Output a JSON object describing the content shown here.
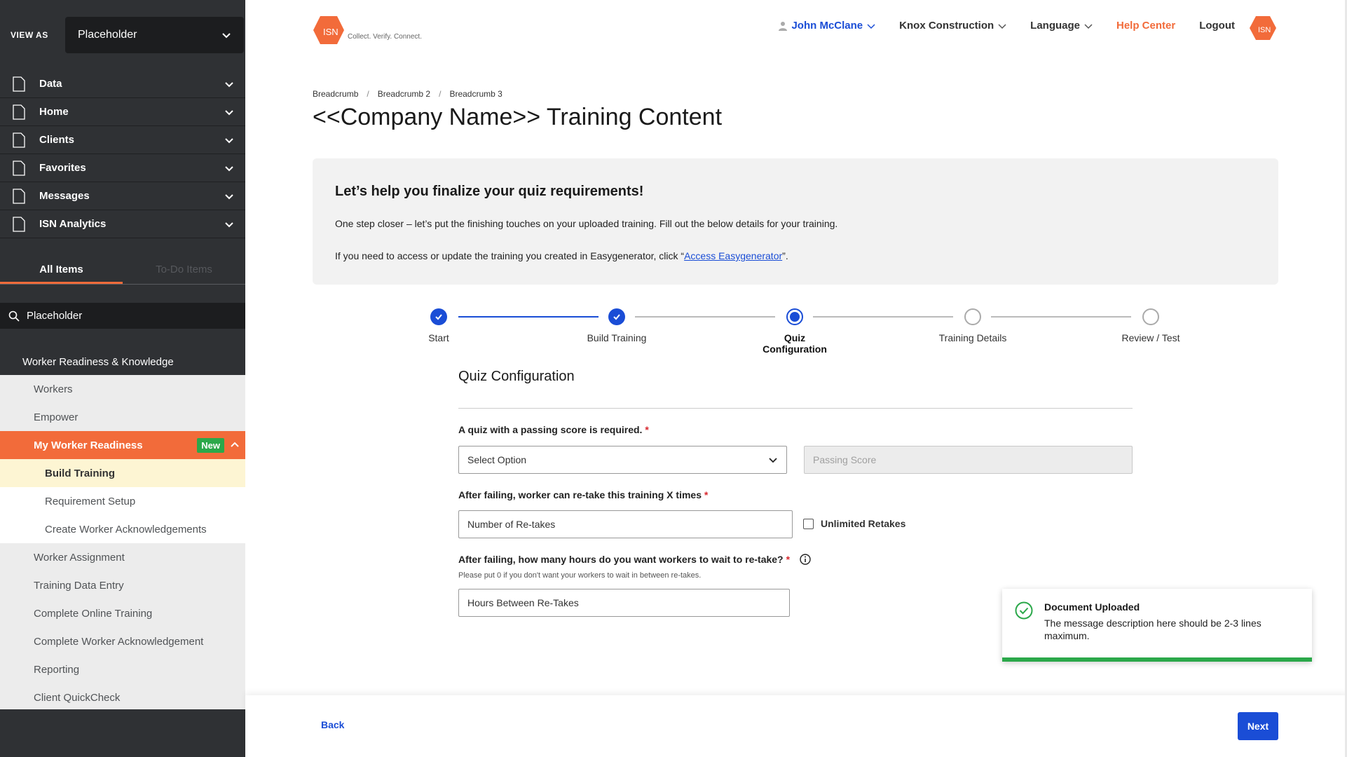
{
  "sidebar": {
    "view_as_label": "VIEW AS",
    "view_as_value": "Placeholder",
    "nav": [
      {
        "label": "Data"
      },
      {
        "label": "Home"
      },
      {
        "label": "Clients"
      },
      {
        "label": "Favorites"
      },
      {
        "label": "Messages"
      },
      {
        "label": "ISN Analytics"
      }
    ],
    "tabs": {
      "all": "All Items",
      "todo": "To-Do Items"
    },
    "search_value": "Placeholder",
    "section": "Worker Readiness & Knowledge",
    "items": {
      "workers": "Workers",
      "empower": "Empower",
      "my_worker_readiness": "My Worker Readiness",
      "new_badge": "New",
      "build_training": "Build Training",
      "requirement_setup": "Requirement Setup",
      "create_ack": "Create Worker Acknowledgements",
      "worker_assignment": "Worker Assignment",
      "training_data_entry": "Training Data Entry",
      "complete_online": "Complete Online Training",
      "complete_ack": "Complete Worker Acknowledgement",
      "reporting": "Reporting",
      "client_quickcheck": "Client QuickCheck"
    }
  },
  "header": {
    "logo_text": "ISN",
    "logo_tagline": "Collect. Verify. Connect.",
    "user": "John McClane",
    "company": "Knox Construction",
    "language": "Language",
    "help": "Help Center",
    "logout": "Logout"
  },
  "breadcrumb": [
    "Breadcrumb",
    "Breadcrumb 2",
    "Breadcrumb 3"
  ],
  "page_title": "<<Company Name>> Training Content",
  "intro": {
    "heading": "Let’s help you finalize your quiz requirements!",
    "line1": "One step closer – let’s put the finishing touches on your uploaded training. Fill out the below details for your training.",
    "line2_pre": "If you need to access or update the training you created in Easygenerator, click “",
    "line2_link": "Access Easygenerator",
    "line2_post": "”."
  },
  "stepper": {
    "steps": [
      "Start",
      "Build Training",
      "Quiz Configuration",
      "Training Details",
      "Review / Test"
    ],
    "current_index": 2
  },
  "form": {
    "title": "Quiz Configuration",
    "q1_label": "A quiz with a passing score is required.",
    "q1_select": "Select Option",
    "q1_passing_placeholder": "Passing Score",
    "q2_label": "After failing, worker can re-take this training X times",
    "q2_value": "Number of Re-takes",
    "q2_checkbox": "Unlimited Retakes",
    "q3_label": "After failing, how many hours do you want workers to wait to re-take?",
    "q3_hint": "Please put 0 if you don't want your workers to wait in between re-takes.",
    "q3_value": "Hours Between Re-Takes",
    "required_mark": "*"
  },
  "toast": {
    "title": "Document Uploaded",
    "description": "The message description here should be 2-3 lines maximum."
  },
  "footer": {
    "back": "Back",
    "next": "Next"
  },
  "colors": {
    "accent": "#f26b3a",
    "primary": "#1a4dd6",
    "success": "#2ba84a",
    "sidebar": "#2f3134"
  }
}
